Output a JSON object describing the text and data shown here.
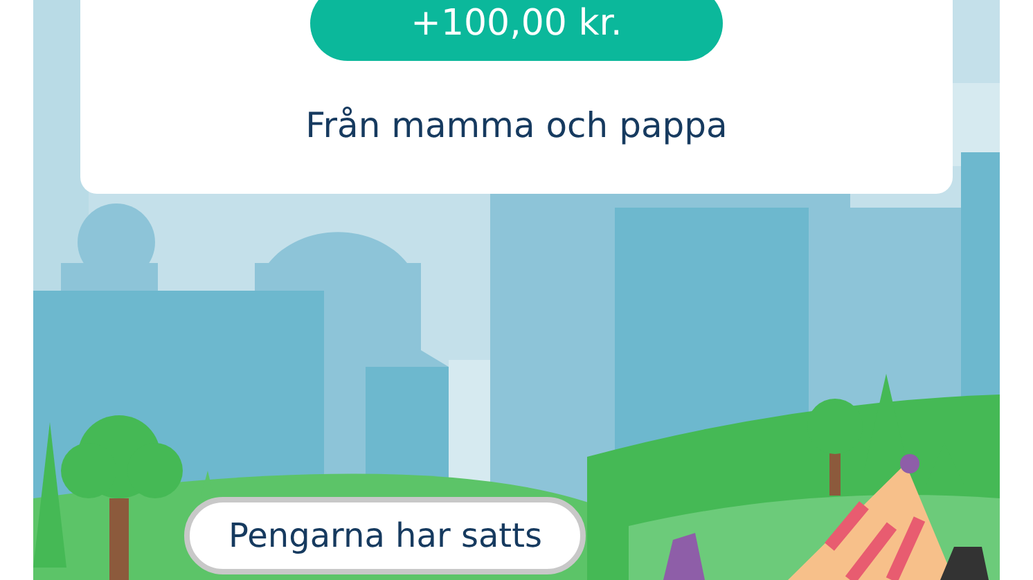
{
  "transfer_card": {
    "amount": "+100,00 kr.",
    "message": "Från mamma och pappa"
  },
  "speech_bubble": {
    "text": "Pengarna har satts"
  }
}
